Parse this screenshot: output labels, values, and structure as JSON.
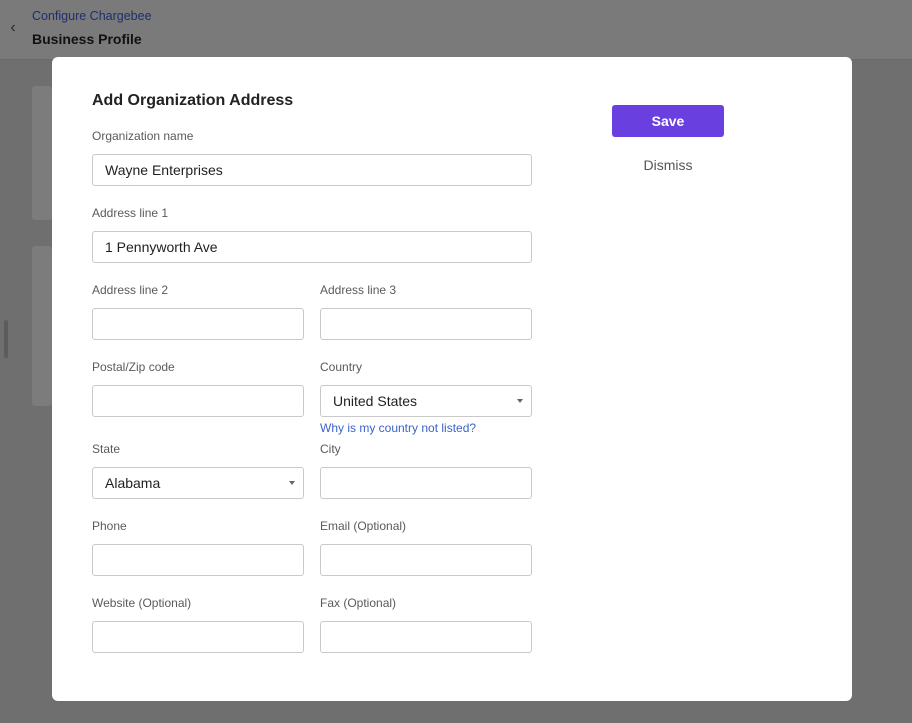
{
  "header": {
    "breadcrumb": "Configure Chargebee",
    "title": "Business Profile",
    "back_icon": "chevron-left-icon"
  },
  "modal": {
    "title": "Add Organization Address",
    "save_label": "Save",
    "dismiss_label": "Dismiss",
    "save_color": "#6a3fe0",
    "fields": {
      "org_name": {
        "label": "Organization name",
        "value": "Wayne Enterprises"
      },
      "address1": {
        "label": "Address line 1",
        "value": "1 Pennyworth Ave"
      },
      "address2": {
        "label": "Address line 2",
        "value": ""
      },
      "address3": {
        "label": "Address line 3",
        "value": ""
      },
      "postal": {
        "label": "Postal/Zip code",
        "value": ""
      },
      "country": {
        "label": "Country",
        "value": "United States"
      },
      "country_help": "Why is my country not listed?",
      "state": {
        "label": "State",
        "value": "Alabama"
      },
      "city": {
        "label": "City",
        "value": ""
      },
      "phone": {
        "label": "Phone",
        "value": ""
      },
      "email": {
        "label": "Email (Optional)",
        "value": ""
      },
      "website": {
        "label": "Website (Optional)",
        "value": ""
      },
      "fax": {
        "label": "Fax (Optional)",
        "value": ""
      }
    }
  }
}
